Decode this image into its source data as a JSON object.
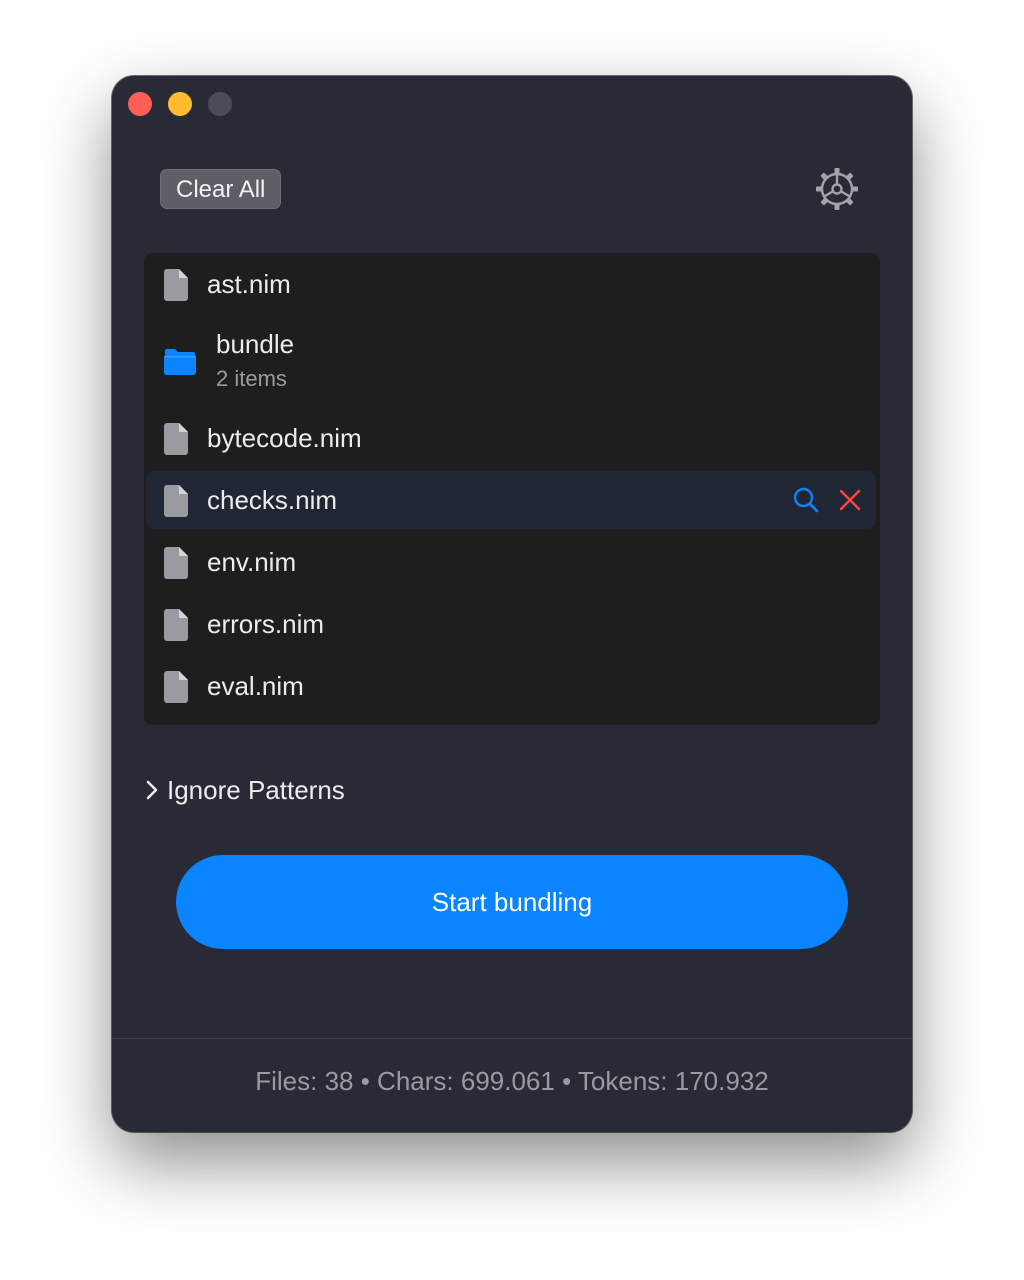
{
  "window": {
    "controls": [
      "close",
      "minimize",
      "zoom"
    ]
  },
  "toolbar": {
    "clear_all_label": "Clear All",
    "settings_icon": "gear-icon"
  },
  "files": [
    {
      "name": "ast.nim",
      "kind": "file",
      "icon": "file-icon"
    },
    {
      "name": "bundle",
      "kind": "folder",
      "icon": "folder-icon",
      "subtitle": "2 items"
    },
    {
      "name": "bytecode.nim",
      "kind": "file",
      "icon": "file-icon"
    },
    {
      "name": "checks.nim",
      "kind": "file",
      "icon": "file-icon",
      "selected": true,
      "actions": [
        "search-icon",
        "remove-icon"
      ]
    },
    {
      "name": "env.nim",
      "kind": "file",
      "icon": "file-icon"
    },
    {
      "name": "errors.nim",
      "kind": "file",
      "icon": "file-icon"
    },
    {
      "name": "eval.nim",
      "kind": "file",
      "icon": "file-icon"
    }
  ],
  "ignore_patterns": {
    "label": "Ignore Patterns",
    "expanded": false
  },
  "start_button": {
    "label": "Start bundling"
  },
  "status": {
    "text": "Files: 38 • Chars: 699.061 • Tokens: 170.932"
  },
  "colors": {
    "window_bg": "#282a36",
    "list_bg": "#1e1e1e",
    "selected_row_bg": "#202634",
    "accent": "#0a84ff",
    "remove": "#ff453a",
    "folder": "#0a84ff",
    "file_icon": "#9a9ba1",
    "text": "#ececec",
    "muted_text": "#9a9ba1"
  }
}
